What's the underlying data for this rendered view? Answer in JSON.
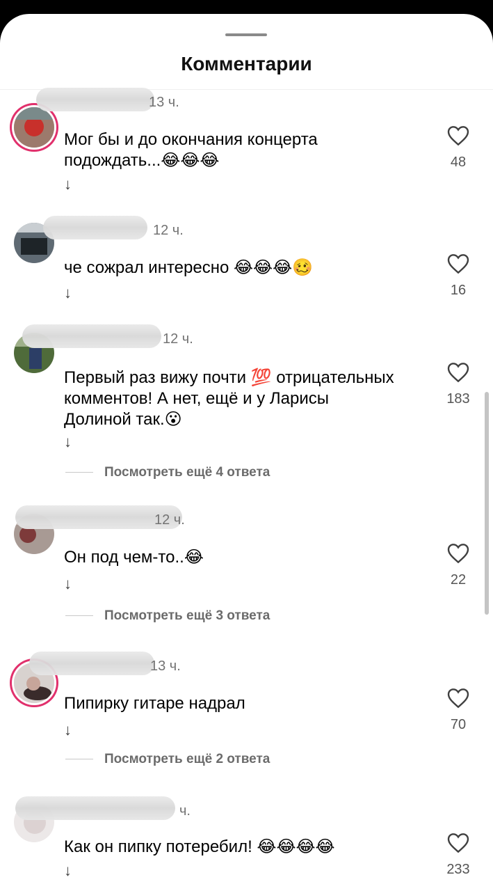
{
  "header": {
    "title": "Комментарии"
  },
  "comments": [
    {
      "time": "13 ч.",
      "text": "Мог бы и до окончания концерта\nподождать...😂😂😂",
      "likes": "48"
    },
    {
      "time": "12 ч.",
      "text": "че сожрал интересно 😂😂😂🥴",
      "likes": "16"
    },
    {
      "time": "12 ч.",
      "text": "Первый раз вижу почти 💯 отрицательных\nкомментов! А нет, ещё и у Ларисы\nДолиной так.😮",
      "likes": "183"
    },
    {
      "time": "12 ч.",
      "text": "Он под чем-то..😂",
      "likes": "22"
    },
    {
      "time": "13 ч.",
      "text": "Пипирку гитаре надрал",
      "likes": "70"
    },
    {
      "time": "ч.",
      "text": "Как он пипку потеребил! 😂😂😂😂",
      "likes": "233"
    }
  ],
  "view_more": [
    "Посмотреть ещё 4 ответа",
    "Посмотреть ещё 3 ответа",
    "Посмотреть ещё 2 ответа"
  ],
  "reply_icon": "arrow-down-icon",
  "like_icon": "heart-outline-icon",
  "colors": {
    "story_ring": "#e1306c",
    "text": "#000000",
    "muted": "#737373"
  }
}
